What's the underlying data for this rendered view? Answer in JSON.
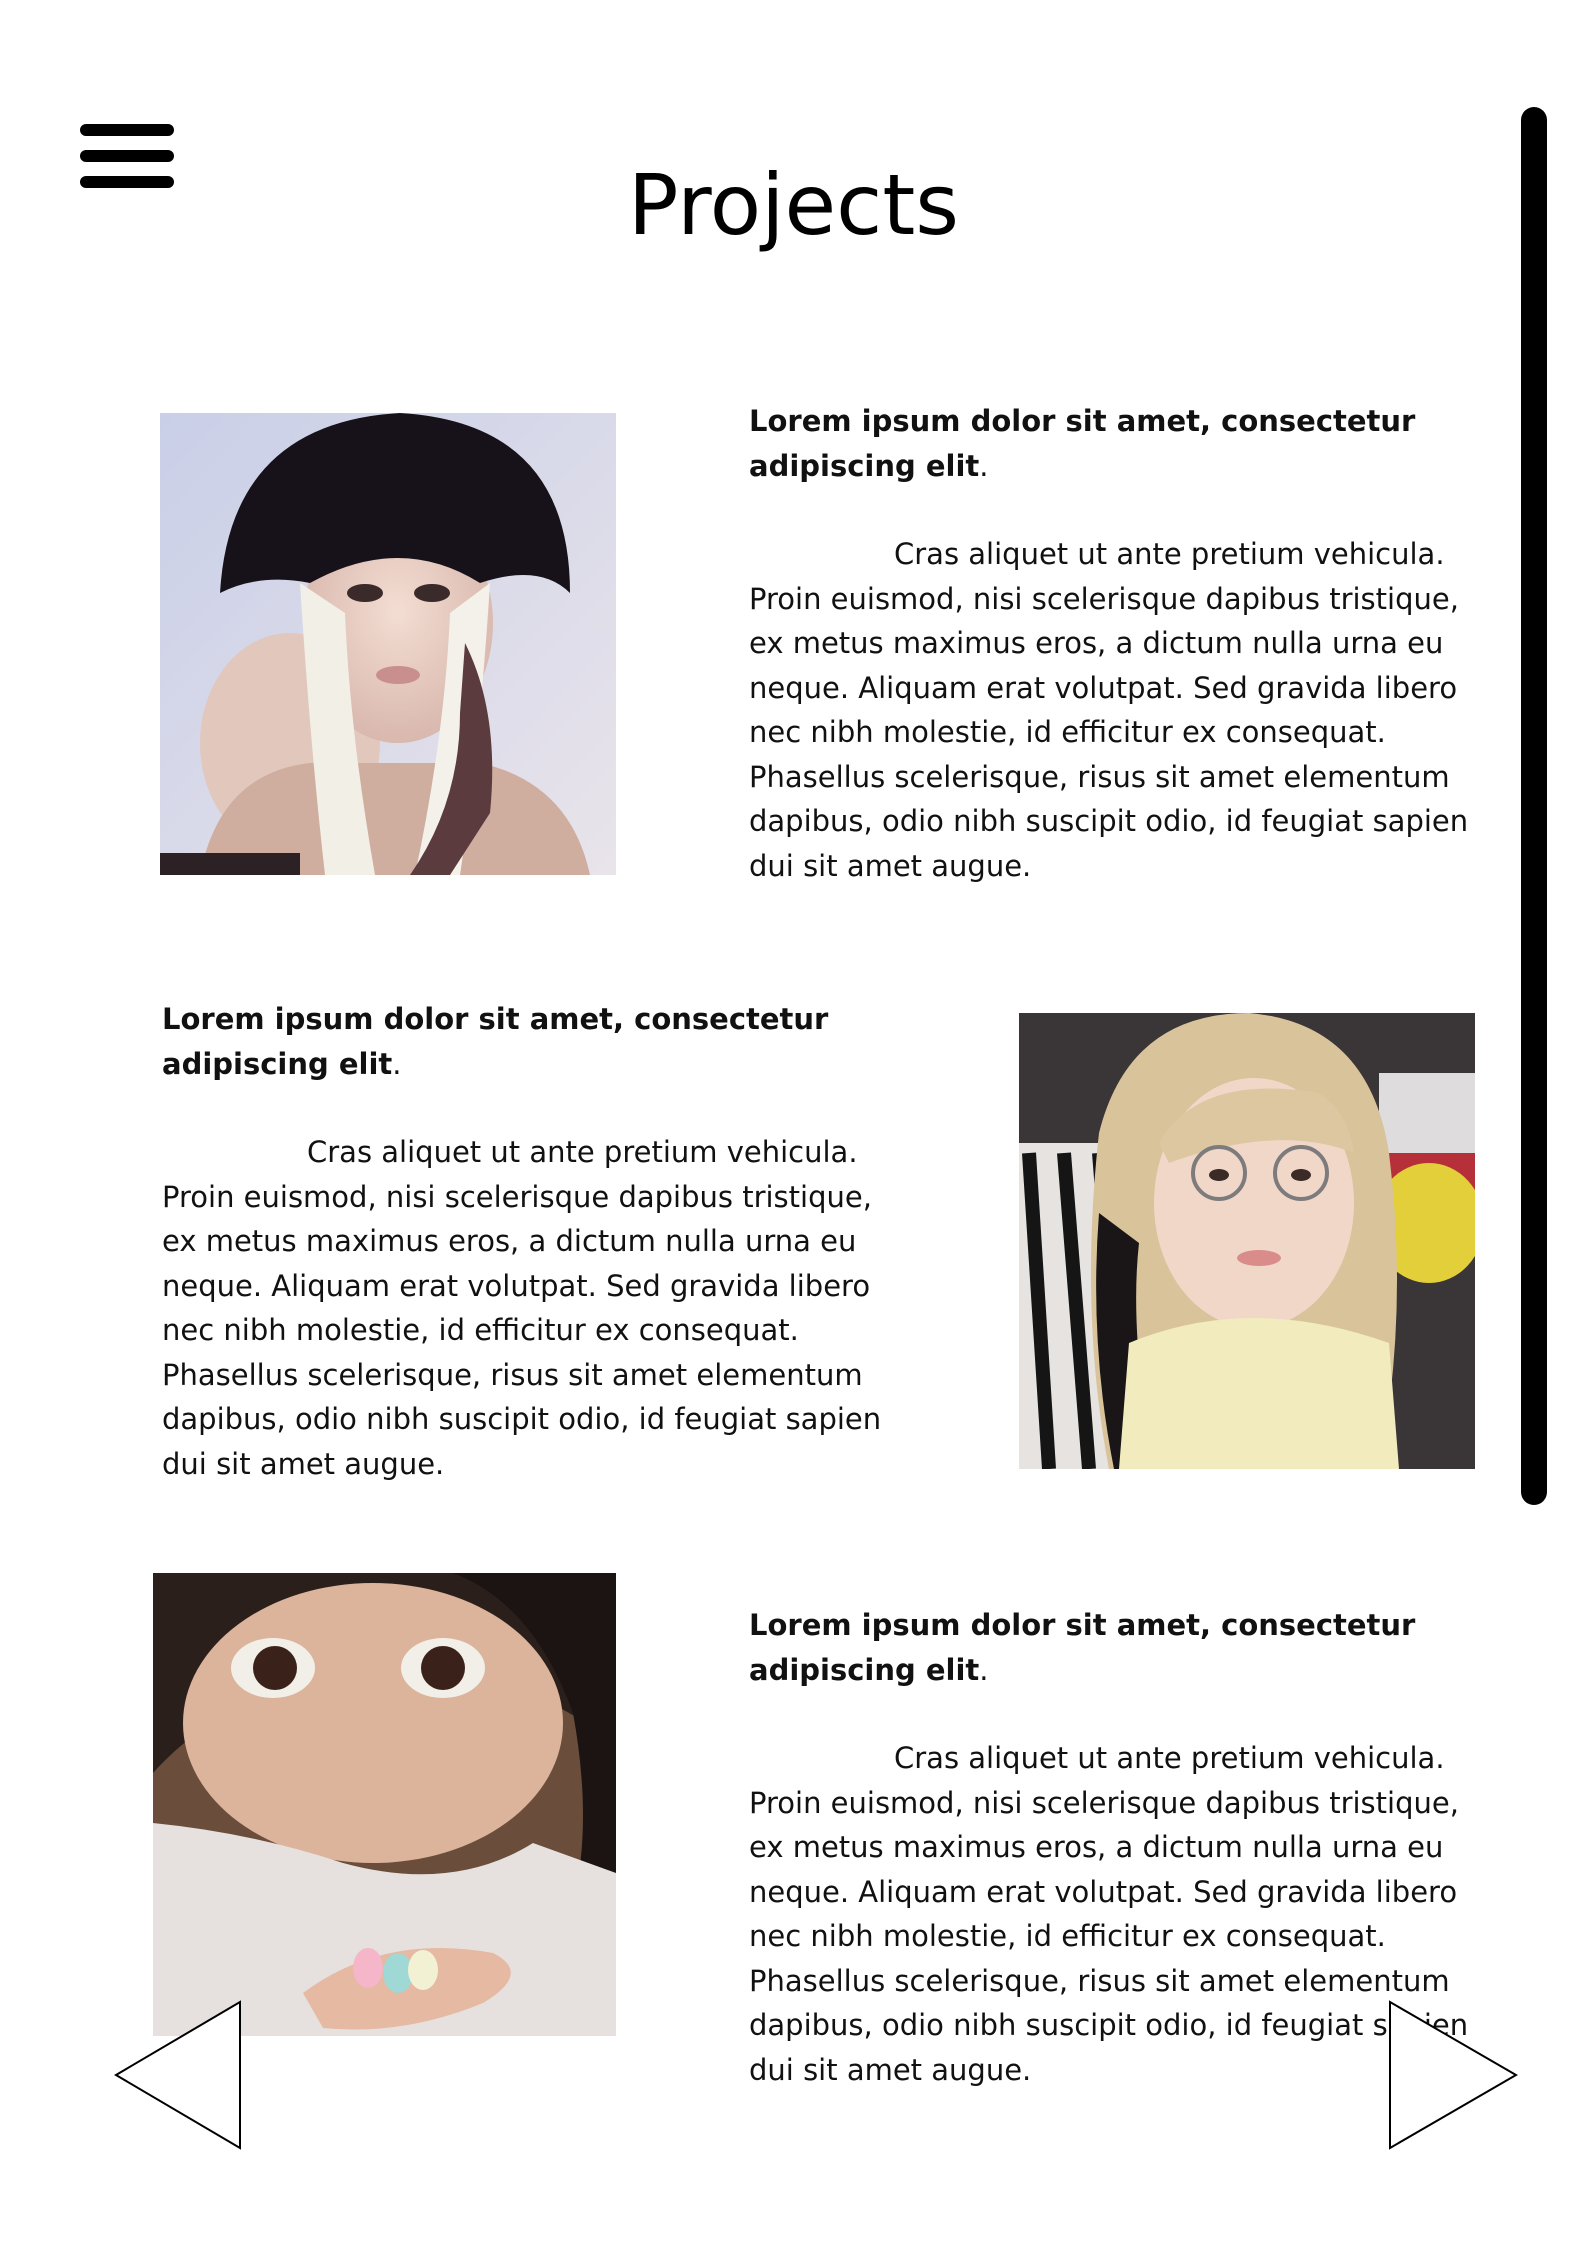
{
  "header": {
    "title": "Projects",
    "menu_icon": "hamburger-menu-icon"
  },
  "projects": [
    {
      "heading": "Lorem ipsum dolor sit amet, consectetur adipiscing elit",
      "heading_end": ".",
      "body": "Cras aliquet ut ante pretium vehicula. Proin euismod, nisi scelerisque dapibus tristique, ex metus maximus eros, a dictum nulla urna eu neque. Aliquam erat volutpat. Sed gravida libero nec nibh molestie, id efficitur ex consequat. Phasellus scelerisque, risus sit amet elementum dapibus, odio nibh suscipit odio, id feugiat sapien dui sit amet augue."
    },
    {
      "heading": "Lorem ipsum dolor sit amet, consectetur adipiscing elit",
      "heading_end": ".",
      "body": "Cras aliquet ut ante pretium vehicula. Proin euismod, nisi scelerisque dapibus tristique, ex metus maximus eros, a dictum nulla urna eu neque. Aliquam erat volutpat. Sed gravida libero nec nibh molestie, id efficitur ex consequat. Phasellus scelerisque, risus sit amet elementum dapibus, odio nibh suscipit odio, id feugiat sapien dui sit amet augue."
    },
    {
      "heading": "Lorem ipsum dolor sit amet, consectetur adipiscing elit",
      "heading_end": ".",
      "body": "Cras aliquet ut ante pretium vehicula. Proin euismod, nisi scelerisque dapibus tristique, ex metus maximus eros, a dictum nulla urna eu neque. Aliquam erat volutpat. Sed gravida libero nec nibh molestie, id efficitur ex consequat. Phasellus scelerisque, risus sit amet elementum dapibus, odio nibh suscipit odio, id feugiat sapien dui sit amet augue."
    }
  ],
  "navigation": {
    "prev_icon": "triangle-left-icon",
    "next_icon": "triangle-right-icon"
  },
  "colors": {
    "background": "#ffffff",
    "text": "#111111",
    "accent": "#000000"
  }
}
